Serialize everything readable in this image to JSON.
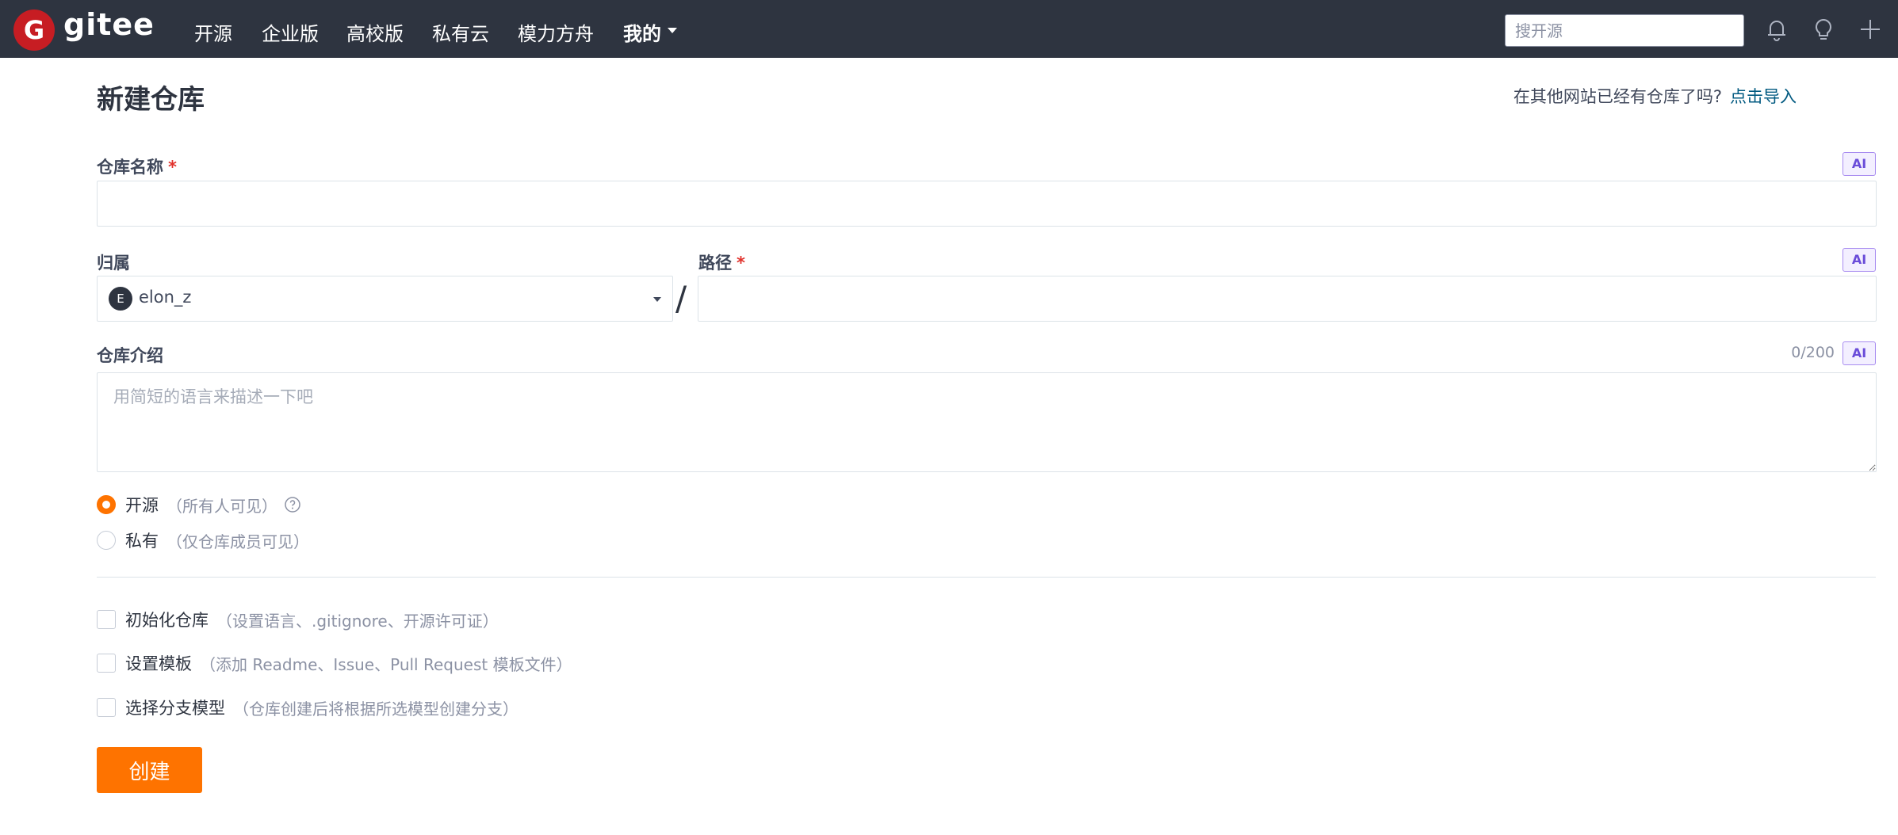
{
  "nav": {
    "logo_letter": "G",
    "brand": "gitee",
    "links": [
      "开源",
      "企业版",
      "高校版",
      "私有云",
      "模力方舟",
      "我的"
    ],
    "search_placeholder": "搜开源"
  },
  "page": {
    "title": "新建仓库",
    "import_prompt": "在其他网站已经有仓库了吗?",
    "import_link": "点击导入"
  },
  "form": {
    "repo_name": {
      "label": "仓库名称",
      "required_mark": "*",
      "value": ""
    },
    "owner": {
      "label": "归属",
      "avatar_letter": "E",
      "value": "elon_z"
    },
    "separator": "/",
    "path": {
      "label": "路径",
      "required_mark": "*",
      "value": ""
    },
    "description": {
      "label": "仓库介绍",
      "placeholder": "用简短的语言来描述一下吧",
      "counter": "0/200",
      "value": ""
    },
    "ai_badge": "AI",
    "visibility": [
      {
        "label": "开源",
        "hint": "（所有人可见）",
        "selected": true
      },
      {
        "label": "私有",
        "hint": "（仅仓库成员可见）",
        "selected": false
      }
    ],
    "options": [
      {
        "label": "初始化仓库",
        "hint": "（设置语言、.gitignore、开源许可证）",
        "checked": false
      },
      {
        "label": "设置模板",
        "hint": "（添加 Readme、Issue、Pull Request 模板文件）",
        "checked": false
      },
      {
        "label": "选择分支模型",
        "hint": "（仓库创建后将根据所选模型创建分支）",
        "checked": false
      }
    ],
    "submit_label": "创建"
  },
  "colors": {
    "nav_bg": "#2e3440",
    "brand_red": "#c71d23",
    "accent_orange": "#fe7300",
    "link_blue": "#005980",
    "ai_purple": "#6a4cd9"
  },
  "icons": [
    "gitee-logo-icon",
    "caret-down-icon",
    "bell-icon",
    "lightbulb-icon",
    "plus-icon",
    "help-circle-icon",
    "resize-handle-icon"
  ]
}
